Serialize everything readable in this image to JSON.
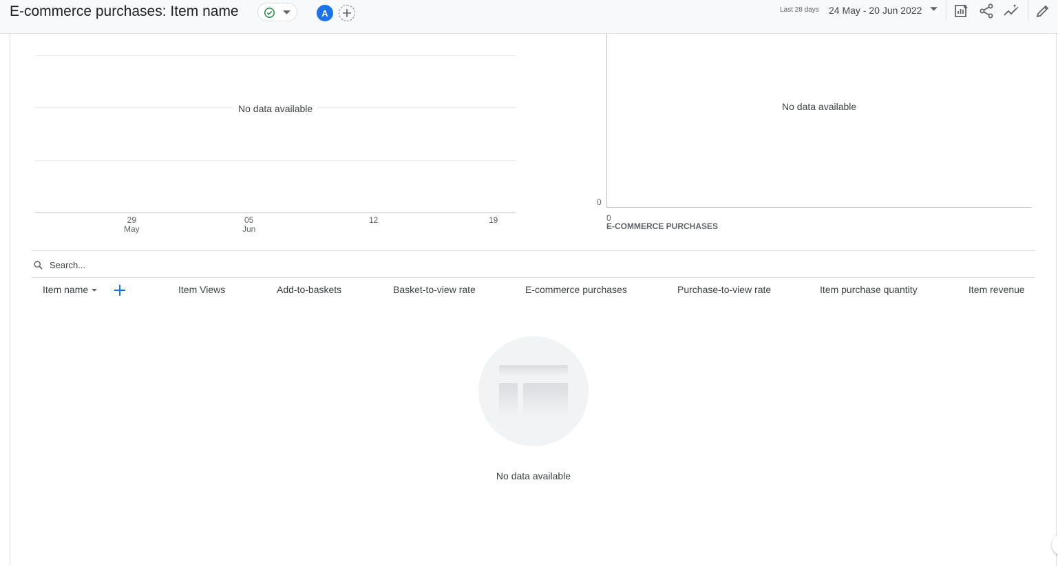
{
  "header": {
    "title": "E-commerce purchases: Item name",
    "avatar_letter": "A",
    "date_label": "Last 28 days",
    "date_range": "24 May - 20 Jun 2022"
  },
  "icons": [
    "check-circle-icon",
    "chevron-down-icon",
    "add-comparison-icon",
    "customize-report-icon",
    "share-icon",
    "insights-icon",
    "edit-icon",
    "search-icon",
    "add-icon"
  ],
  "colors": {
    "accent": "#1a73e8",
    "status_check": "#188038",
    "divider": "#dadce0"
  },
  "line_chart": {
    "no_data": "No data available",
    "x_ticks": [
      {
        "day": "29",
        "month": "May"
      },
      {
        "day": "05",
        "month": "Jun"
      },
      {
        "day": "12",
        "month": ""
      },
      {
        "day": "19",
        "month": ""
      }
    ]
  },
  "bar_chart": {
    "no_data": "No data available",
    "y_tick": "0",
    "x_tick": "0",
    "x_label": "E-COMMERCE PURCHASES"
  },
  "table": {
    "search_placeholder": "Search...",
    "columns": [
      "Item name",
      "Item Views",
      "Add-to-baskets",
      "Basket-to-view rate",
      "E-commerce purchases",
      "Purchase-to-view rate",
      "Item purchase quantity",
      "Item revenue"
    ],
    "empty_text": "No data available"
  }
}
